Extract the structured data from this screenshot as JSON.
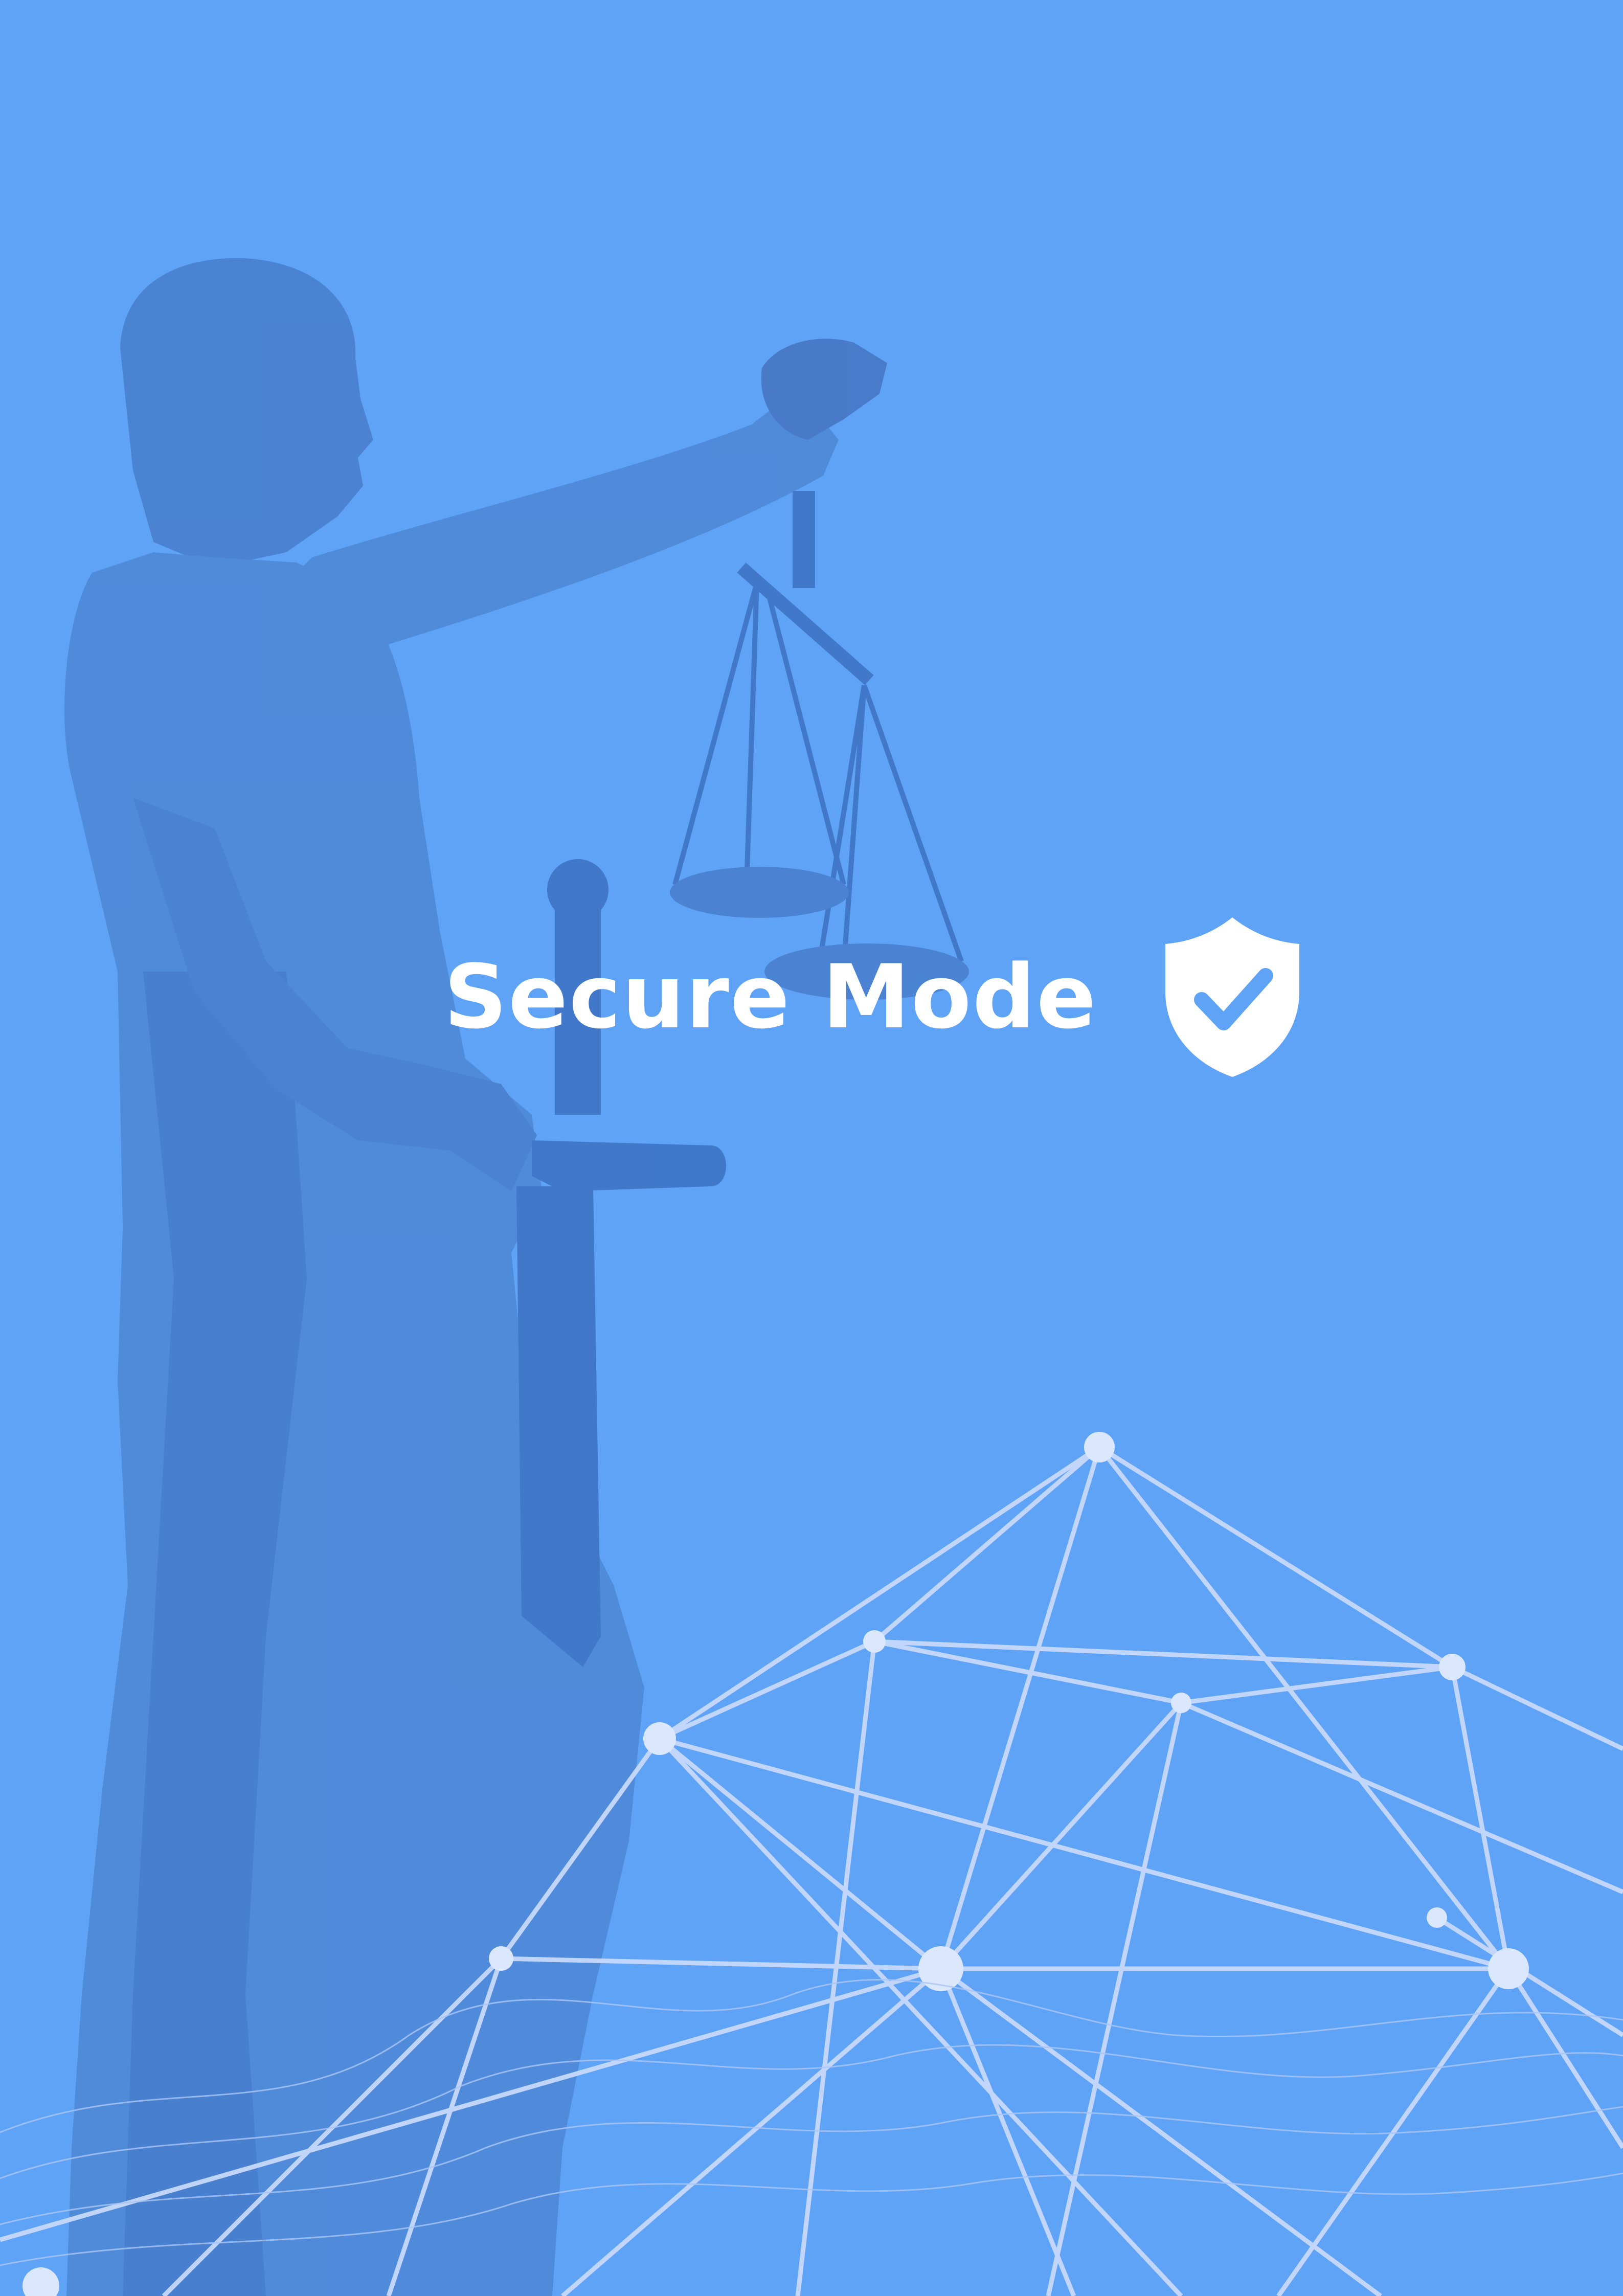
{
  "screen": {
    "title": "Secure Mode",
    "status_icon": "shield-check-icon",
    "background_subjects": [
      "statue-of-justice-image",
      "network-mesh-image"
    ]
  },
  "colors": {
    "background": "#5fa3f7",
    "statue_tint": "#4f89d8",
    "statue_shade": "#3f75c6",
    "mesh_line": "#c7d9fb",
    "mesh_node": "#dbe7fd",
    "text": "#ffffff"
  }
}
